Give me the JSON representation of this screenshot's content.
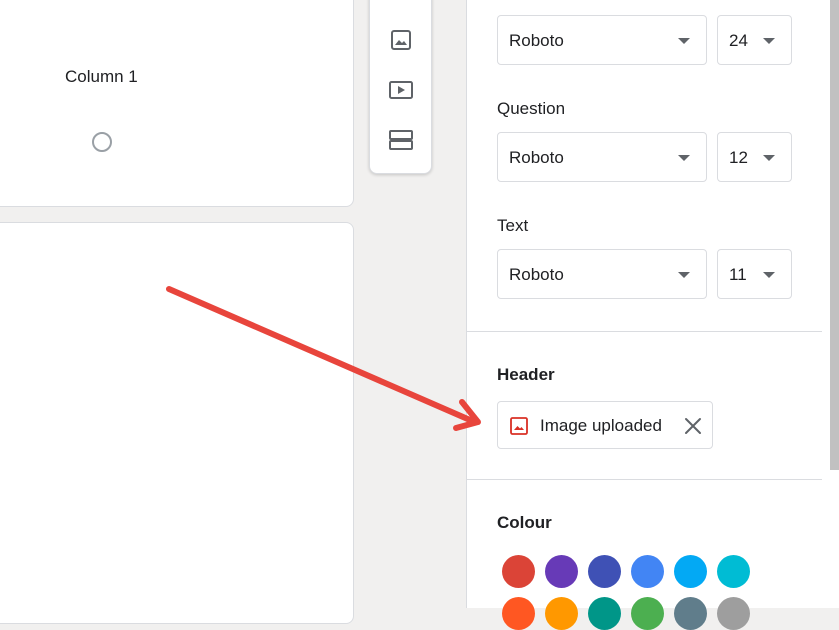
{
  "form": {
    "column_label": "Column 1"
  },
  "toolbar": {
    "icons": [
      "image-icon",
      "video-icon",
      "section-icon"
    ]
  },
  "theme_panel": {
    "title_font": {
      "family": "Roboto",
      "size": "24"
    },
    "question": {
      "label": "Question",
      "family": "Roboto",
      "size": "12"
    },
    "text": {
      "label": "Text",
      "family": "Roboto",
      "size": "11"
    },
    "header": {
      "label": "Header",
      "chip_label": "Image uploaded"
    },
    "colour": {
      "label": "Colour",
      "row1": [
        "#db4437",
        "#673ab7",
        "#3f51b5",
        "#4285f4",
        "#03a9f4",
        "#00bcd4"
      ],
      "row2": [
        "#ff5722",
        "#ff9800",
        "#009688",
        "#4caf50",
        "#607d8b",
        "#9e9e9e"
      ]
    }
  },
  "annotation": {
    "arrow_color": "#e8453c"
  }
}
